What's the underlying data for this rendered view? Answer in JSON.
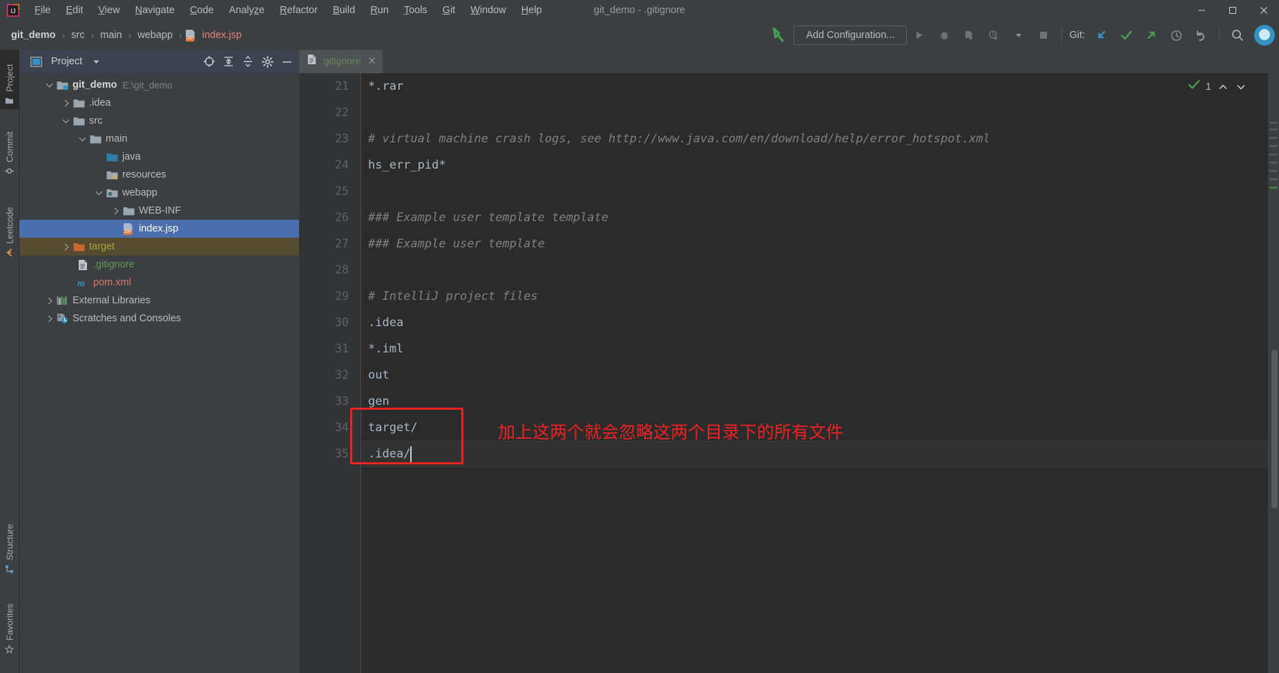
{
  "window": {
    "title": "git_demo - .gitignore",
    "minimize_label": "–",
    "maximize_label": "☐",
    "close_label": "✕"
  },
  "menubar": {
    "items": [
      {
        "label": "File",
        "mnemonic": "F"
      },
      {
        "label": "Edit",
        "mnemonic": "E"
      },
      {
        "label": "View",
        "mnemonic": "V"
      },
      {
        "label": "Navigate",
        "mnemonic": "N"
      },
      {
        "label": "Code",
        "mnemonic": "C"
      },
      {
        "label": "Analyze",
        "mnemonic": "z"
      },
      {
        "label": "Refactor",
        "mnemonic": "R"
      },
      {
        "label": "Build",
        "mnemonic": "B"
      },
      {
        "label": "Run",
        "mnemonic": "R"
      },
      {
        "label": "Tools",
        "mnemonic": "T"
      },
      {
        "label": "Git",
        "mnemonic": "G"
      },
      {
        "label": "Window",
        "mnemonic": "W"
      },
      {
        "label": "Help",
        "mnemonic": "H"
      }
    ]
  },
  "navbar": {
    "crumbs": [
      "git_demo",
      "src",
      "main",
      "webapp",
      "index.jsp"
    ],
    "separator": "›",
    "file_icon": "jsp-file-icon",
    "file_badge": "JSP"
  },
  "toolbar": {
    "run_arrow_icon": "green-arrow-icon",
    "add_configuration_label": "Add Configuration...",
    "run_icon": "run-icon",
    "debug_icon": "debug-icon",
    "run_with_coverage_icon": "run-with-coverage-icon",
    "profile_icon": "profile-icon",
    "dropdown_icon": "chevron-down-icon",
    "stop_icon": "stop-icon",
    "git_label": "Git:",
    "git_update_icon": "update-project-icon",
    "git_commit_icon": "commit-icon",
    "git_push_icon": "push-icon",
    "history_icon": "history-icon",
    "undo_icon": "undo-icon",
    "search_icon": "search-everywhere-icon",
    "account_icon": "account-avatar-icon"
  },
  "left_strip": {
    "tabs": [
      {
        "label": "Project",
        "icon": "project-icon",
        "selected": true
      },
      {
        "label": "Commit",
        "icon": "commit-icon",
        "selected": false
      },
      {
        "label": "Leetcode",
        "icon": "leetcode-icon",
        "selected": false
      }
    ],
    "bottom_tabs": [
      {
        "label": "Structure",
        "icon": "structure-icon"
      },
      {
        "label": "Favorites",
        "icon": "favorites-icon"
      }
    ]
  },
  "project_panel": {
    "title": "Project",
    "view_icon": "project-view-icon",
    "dropdown_icon": "chevron-down-icon",
    "actions": [
      {
        "name": "select-opened-file-icon",
        "label": "Select Opened File"
      },
      {
        "name": "expand-all-icon",
        "label": "Expand All"
      },
      {
        "name": "collapse-all-icon",
        "label": "Collapse All"
      },
      {
        "name": "settings-gear-icon",
        "label": "Settings"
      },
      {
        "name": "hide-icon",
        "label": "Hide"
      }
    ],
    "tree": [
      {
        "label": "git_demo",
        "sub": "E:\\git_demo",
        "indent": 0,
        "twisty": "down",
        "icon": "module-folder-icon",
        "style": "root",
        "selected": false
      },
      {
        "label": ".idea",
        "sub": "",
        "indent": 1,
        "twisty": "right",
        "icon": "folder-icon",
        "style": "plain",
        "selected": false
      },
      {
        "label": "src",
        "sub": "",
        "indent": 1,
        "twisty": "down",
        "icon": "folder-icon",
        "style": "plain",
        "selected": false
      },
      {
        "label": "main",
        "sub": "",
        "indent": 2,
        "twisty": "down",
        "icon": "folder-icon",
        "style": "plain",
        "selected": false
      },
      {
        "label": "java",
        "sub": "",
        "indent": 3,
        "twisty": "none",
        "icon": "source-root-folder-icon",
        "style": "plain",
        "selected": false
      },
      {
        "label": "resources",
        "sub": "",
        "indent": 3,
        "twisty": "none",
        "icon": "resource-root-folder-icon",
        "style": "plain",
        "selected": false
      },
      {
        "label": "webapp",
        "sub": "",
        "indent": 3,
        "twisty": "down",
        "icon": "webapp-folder-icon",
        "style": "plain",
        "selected": false
      },
      {
        "label": "WEB-INF",
        "sub": "",
        "indent": 4,
        "twisty": "right",
        "icon": "folder-icon",
        "style": "plain",
        "selected": false
      },
      {
        "label": "index.jsp",
        "sub": "",
        "indent": 4,
        "twisty": "none",
        "icon": "jsp-file-icon",
        "style": "plain",
        "selected": true
      },
      {
        "label": "target",
        "sub": "",
        "indent": 1,
        "twisty": "right",
        "icon": "excluded-folder-icon",
        "style": "excluded",
        "selected": false
      },
      {
        "label": ".gitignore",
        "sub": "",
        "indent": 2,
        "twisty": "none",
        "icon": "gitignore-file-icon",
        "style": "green",
        "selected": false
      },
      {
        "label": "pom.xml",
        "sub": "",
        "indent": 2,
        "twisty": "none",
        "icon": "maven-file-icon",
        "style": "red",
        "selected": false
      },
      {
        "label": "External Libraries",
        "sub": "",
        "indent": 0,
        "twisty": "right",
        "icon": "libraries-icon",
        "style": "plain",
        "selected": false
      },
      {
        "label": "Scratches and Consoles",
        "sub": "",
        "indent": 0,
        "twisty": "right",
        "icon": "scratches-icon",
        "style": "plain",
        "selected": false
      }
    ]
  },
  "editor": {
    "tab": {
      "label": ".gitignore",
      "icon": "gitignore-file-icon",
      "close_icon": "close-icon"
    },
    "inspection": {
      "count": "1",
      "ok_icon": "inspection-ok-icon",
      "up_icon": "chevron-up-icon",
      "down_icon": "chevron-down-icon"
    },
    "first_line_number": 21,
    "lines": [
      {
        "n": 21,
        "text": "*.rar",
        "kind": "code"
      },
      {
        "n": 22,
        "text": "",
        "kind": "code"
      },
      {
        "n": 23,
        "text": "# virtual machine crash logs, see http://www.java.com/en/download/help/error_hotspot.xml",
        "kind": "comment"
      },
      {
        "n": 24,
        "text": "hs_err_pid*",
        "kind": "code"
      },
      {
        "n": 25,
        "text": "",
        "kind": "code"
      },
      {
        "n": 26,
        "text": "### Example user template template",
        "kind": "comment"
      },
      {
        "n": 27,
        "text": "### Example user template",
        "kind": "comment"
      },
      {
        "n": 28,
        "text": "",
        "kind": "code"
      },
      {
        "n": 29,
        "text": "# IntelliJ project files",
        "kind": "comment"
      },
      {
        "n": 30,
        "text": ".idea",
        "kind": "code"
      },
      {
        "n": 31,
        "text": "*.iml",
        "kind": "code"
      },
      {
        "n": 32,
        "text": "out",
        "kind": "code"
      },
      {
        "n": 33,
        "text": "gen",
        "kind": "code"
      },
      {
        "n": 34,
        "text": "target/",
        "kind": "code"
      },
      {
        "n": 35,
        "text": ".idea/",
        "kind": "code"
      }
    ],
    "caret_line": 35
  },
  "annotation": {
    "text": "加上这两个就会忽略这两个目录下的所有文件",
    "color": "#ee2222",
    "box_lines": [
      "target/",
      ".idea/"
    ]
  },
  "colors": {
    "accent_blue": "#4b6eaf",
    "comment_gray": "#808080",
    "code_fg": "#a9b7c6",
    "green": "#6a8759",
    "orange": "#cc7832",
    "excluded_bg": "#544b30",
    "panel_bg": "#3c3f41",
    "editor_bg": "#2b2b2b",
    "annotation_red": "#ee2222"
  }
}
